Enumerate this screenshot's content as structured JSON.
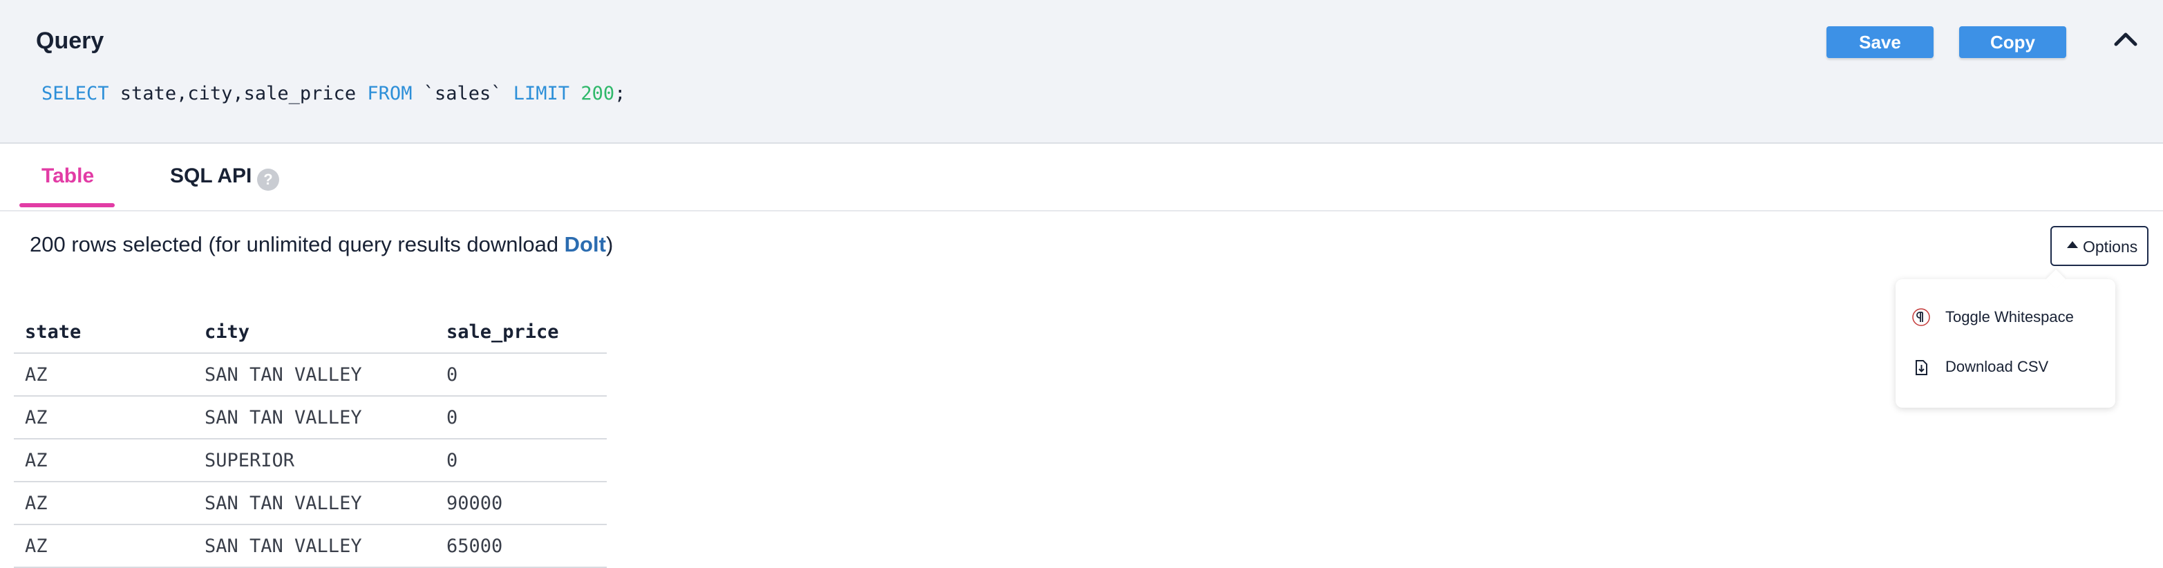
{
  "query": {
    "title": "Query",
    "sql": {
      "kw_select": "SELECT",
      "columns": " state,city,sale_price ",
      "kw_from": "FROM",
      "table": " `sales` ",
      "kw_limit": "LIMIT",
      "limit_value": "200",
      "terminator": ";"
    },
    "save_label": "Save",
    "copy_label": "Copy"
  },
  "tabs": [
    {
      "label": "Table",
      "active": true
    },
    {
      "label": "SQL API",
      "active": false
    }
  ],
  "help_glyph": "?",
  "results": {
    "summary_prefix": "200 rows selected (for unlimited query results download ",
    "summary_link": "Dolt",
    "summary_suffix": ")",
    "options_label": "Options",
    "menu": [
      {
        "label": "Toggle Whitespace",
        "icon": "pilcrow-icon"
      },
      {
        "label": "Download CSV",
        "icon": "file-download-icon"
      }
    ],
    "columns": [
      "state",
      "city",
      "sale_price"
    ],
    "rows": [
      [
        "AZ",
        "SAN TAN VALLEY",
        "0"
      ],
      [
        "AZ",
        "SAN TAN VALLEY",
        "0"
      ],
      [
        "AZ",
        "SUPERIOR",
        "0"
      ],
      [
        "AZ",
        "SAN TAN VALLEY",
        "90000"
      ],
      [
        "AZ",
        "SAN TAN VALLEY",
        "65000"
      ]
    ]
  },
  "colors": {
    "accent_pink": "#e23ca5",
    "button_blue": "#3d91e6",
    "link_blue": "#2b6cb0",
    "sql_keyword": "#2d8fd8",
    "sql_number": "#2fb86a"
  }
}
